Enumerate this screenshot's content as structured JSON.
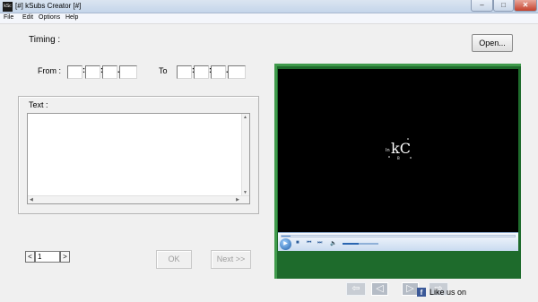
{
  "window": {
    "title": "[#] kSubs Creator [#]",
    "icon_text": "kSc",
    "minimize": "–",
    "maximize": "□",
    "close": "✕"
  },
  "menu": {
    "items": [
      "File",
      "Edit",
      "Options",
      "Help"
    ]
  },
  "timing": {
    "label": "Timing :",
    "from_label": "From :",
    "to_label": "To",
    "from": {
      "hours": "",
      "minutes": "",
      "seconds": "",
      "millis": ""
    },
    "to": {
      "hours": "",
      "minutes": "",
      "seconds": "",
      "millis": ""
    },
    "separators": [
      ":",
      ":",
      "."
    ]
  },
  "open_button": "Open...",
  "text_group": {
    "label": "Text :",
    "value": ""
  },
  "pager": {
    "prev": "<",
    "value": "1",
    "next": ">"
  },
  "ok_button": "OK",
  "next_button": "Next >>",
  "player": {
    "logo_text": "kC",
    "logo_prefix": "In",
    "logo_marks": "B",
    "progress_fraction": 0.04,
    "volume_fraction": 0.45
  },
  "nav_arrows": [
    "⇦",
    "◁",
    "▷",
    "⇨"
  ],
  "like": {
    "icon": "f",
    "text": "Like us on"
  },
  "colors": {
    "player_green": "#1e6b2c",
    "facebook_blue": "#3b5998"
  }
}
